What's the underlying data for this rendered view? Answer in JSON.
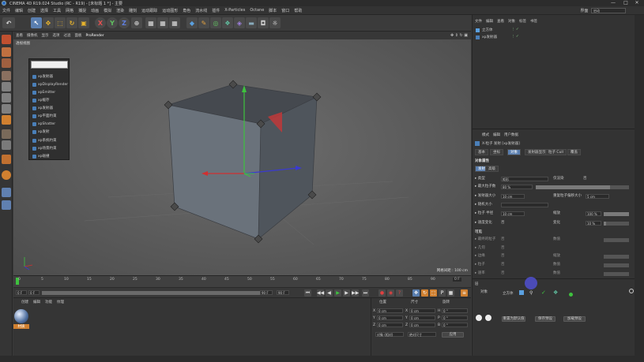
{
  "window": {
    "title": "CINEMA 4D R19.024 Studio (RC - R19) - [未标题 1 *] - 主要",
    "min": "—",
    "max": "□",
    "close": "✕"
  },
  "menubar": {
    "items": [
      "文件",
      "编辑",
      "创建",
      "选择",
      "工具",
      "网格",
      "捕捉",
      "动画",
      "模拟",
      "渲染",
      "雕刻",
      "运动跟踪",
      "运动图形",
      "角色",
      "流水线",
      "插件",
      "X-Particles",
      "Octane",
      "脚本",
      "窗口",
      "帮助"
    ],
    "layout_label": "界面",
    "layout_value": "启动"
  },
  "toolbar": {
    "axis_x": "X",
    "axis_y": "Y",
    "axis_z": "Z"
  },
  "viewport": {
    "menus": [
      "查看",
      "摄像机",
      "显示",
      "选项",
      "过滤",
      "面板",
      "ProRender"
    ],
    "view_label": "透视视图",
    "grid_info": "网格间距 : 100 cm"
  },
  "popup": {
    "items": [
      "xp发射器",
      "xpDisplayRender",
      "xpEmitter",
      "xp缓存",
      "xp发射器",
      "xp平面约束",
      "xpShatter",
      "xp发射",
      "xp系统约束",
      "xp场景约束",
      "xp碰撞"
    ]
  },
  "timeline": {
    "ticks": [
      "0",
      "5",
      "10",
      "15",
      "20",
      "25",
      "30",
      "35",
      "40",
      "45",
      "50",
      "55",
      "60",
      "65",
      "70",
      "75",
      "80",
      "85",
      "90"
    ],
    "end_frame": "0 F",
    "start": "0 F",
    "start2": "0 F",
    "end": "90 F",
    "end2": "90 F"
  },
  "material": {
    "menus": [
      "创建",
      "编辑",
      "功能",
      "纹理"
    ],
    "mat_name": "材质"
  },
  "coords": {
    "headers": [
      "位置",
      "尺寸",
      "旋转"
    ],
    "rows": [
      {
        "axis": "X",
        "pos": "0 cm",
        "size": "0 cm",
        "rlabel": "H",
        "rot": "0 °"
      },
      {
        "axis": "Y",
        "pos": "0 cm",
        "size": "0 cm",
        "rlabel": "P",
        "rot": "0 °"
      },
      {
        "axis": "Z",
        "pos": "0 cm",
        "size": "0 cm",
        "rlabel": "B",
        "rot": "0 °"
      }
    ],
    "mode": "对象 (相对)",
    "size_mode": "绝对尺寸",
    "apply": "应用"
  },
  "objects": {
    "menus": [
      "文件",
      "编辑",
      "查看",
      "对象",
      "标签",
      "书签"
    ],
    "items": [
      {
        "name": "立方体"
      },
      {
        "name": "xp发射器"
      }
    ]
  },
  "attributes": {
    "menus": [
      "模式",
      "编辑",
      "用户数据"
    ],
    "object_title": "X-粒子 发射 [xp发射器]",
    "tabs": [
      "基本",
      "坐标",
      "对象",
      "发射器显示",
      "粒子 Cull",
      "覆盖"
    ],
    "section": "对象属性",
    "subtabs": [
      "发射",
      "高级"
    ],
    "rows": [
      {
        "label": "▸ 类型",
        "value": "矩形",
        "r_label": "仅渲染",
        "r_value": "否"
      },
      {
        "label": "▸ 最大粒子数",
        "value": "80 %"
      },
      {
        "label": "▸ 发射器大小",
        "value": "10 cm",
        "r_label": "重复粒子偏移大小",
        "r_value": "5 cm"
      },
      {
        "label": "▸ 随机大小",
        "value": ""
      },
      {
        "label": "▸ 粒子 半径",
        "value": "10 cm",
        "r_label": "缩放",
        "r_value": "100 %"
      },
      {
        "label": "▸ 速度变化",
        "value": "否",
        "r_label": "变化",
        "r_value": "10 %"
      }
    ],
    "section2": "可见",
    "rows2": [
      {
        "label": "▸ 最终的粒子",
        "value": "否",
        "r_label": "数值"
      },
      {
        "label": "▸ 几何",
        "value": "否"
      },
      {
        "label": "▸ 边缘",
        "value": "否",
        "r_label": "缩放"
      },
      {
        "label": "▸ 粒子",
        "value": "否",
        "r_label": "数值"
      },
      {
        "label": "▸ 速率",
        "value": "否",
        "r_label": "数值"
      }
    ]
  },
  "layers": {
    "header": "层",
    "label": "对象",
    "obj": "立方体",
    "buttons": [
      "重置为默认值",
      "保存预设",
      "加载预设"
    ]
  },
  "colors": {
    "accent": "#5a7fb0",
    "cube": "#5f6770"
  }
}
